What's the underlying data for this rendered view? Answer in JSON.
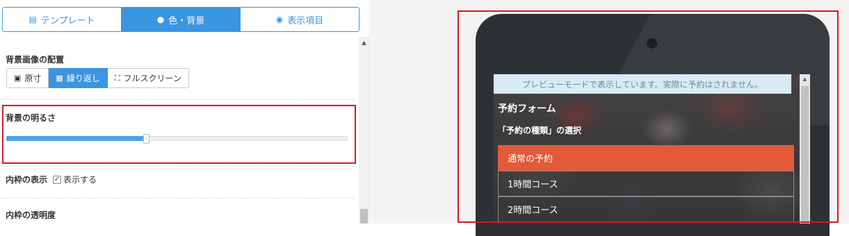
{
  "tabs": [
    {
      "label": "テンプレート",
      "icon": "list-icon",
      "active": false
    },
    {
      "label": "色・背景",
      "icon": "drop-icon",
      "active": true
    },
    {
      "label": "表示項目",
      "icon": "eye-icon",
      "active": false
    }
  ],
  "bg_image": {
    "label": "背景画像の配置",
    "options": [
      {
        "label": "原寸",
        "icon": "image-icon",
        "active": false
      },
      {
        "label": "繰り返し",
        "icon": "grid-icon",
        "active": true
      },
      {
        "label": "フルスクリーン",
        "icon": "fullscreen-icon",
        "active": false
      }
    ]
  },
  "brightness": {
    "label": "背景の明るさ",
    "value": 0.41
  },
  "frame": {
    "label": "内枠の表示",
    "checkbox_label": "表示する",
    "checked": true
  },
  "opacity": {
    "label": "内枠の透明度"
  },
  "colors": {
    "accent": "#3b95e0",
    "highlight": "#d01c24",
    "selected_option": "#e15a3a"
  },
  "preview": {
    "banner": "プレビューモードで表示しています。実際に予約はされません。",
    "form_title": "予約フォーム",
    "form_subtitle": "「予約の種類」の選択",
    "options": [
      {
        "label": "通常の予約",
        "selected": true
      },
      {
        "label": "1時間コース",
        "selected": false
      },
      {
        "label": "2時間コース",
        "selected": false
      }
    ]
  }
}
